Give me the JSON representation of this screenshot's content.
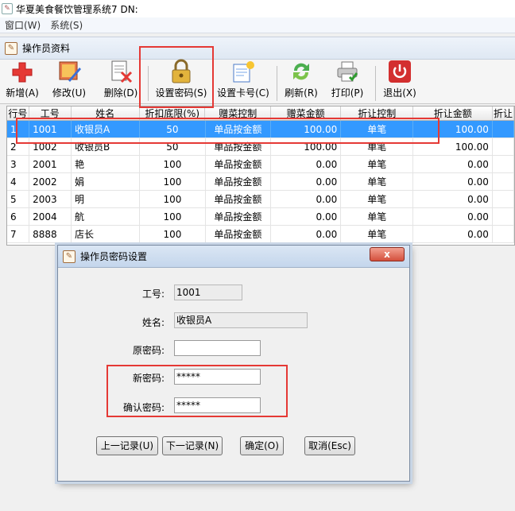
{
  "app": {
    "title": "华夏美食餐饮管理系统7 DN:"
  },
  "menu": [
    "窗口(W)",
    "系统(S)"
  ],
  "subwindow": {
    "title": "操作员资料"
  },
  "toolbar": {
    "add": "新增(A)",
    "edit": "修改(U)",
    "delete": "删除(D)",
    "set_password": "设置密码(S)",
    "set_card": "设置卡号(C)",
    "refresh": "刷新(R)",
    "print": "打印(P)",
    "exit": "退出(X)"
  },
  "grid": {
    "headers": [
      "行号",
      "工号",
      "姓名",
      "折扣底限(%)",
      "赠菜控制",
      "赠菜金额",
      "折让控制",
      "折让金额",
      "折让"
    ],
    "rows": [
      [
        "1",
        "1001",
        "收银员A",
        "50",
        "单品按金额",
        "100.00",
        "单笔",
        "100.00"
      ],
      [
        "2",
        "1002",
        "收银员B",
        "50",
        "单品按金额",
        "100.00",
        "单笔",
        "100.00"
      ],
      [
        "3",
        "2001",
        "艳",
        "100",
        "单品按金额",
        "0.00",
        "单笔",
        "0.00"
      ],
      [
        "4",
        "2002",
        "娟",
        "100",
        "单品按金额",
        "0.00",
        "单笔",
        "0.00"
      ],
      [
        "5",
        "2003",
        "明",
        "100",
        "单品按金额",
        "0.00",
        "单笔",
        "0.00"
      ],
      [
        "6",
        "2004",
        "航",
        "100",
        "单品按金额",
        "0.00",
        "单笔",
        "0.00"
      ],
      [
        "7",
        "8888",
        "店长",
        "100",
        "单品按金额",
        "0.00",
        "单笔",
        "0.00"
      ]
    ]
  },
  "dialog": {
    "title": "操作员密码设置",
    "close": "x",
    "labels": {
      "job_no": "工号:",
      "name": "姓名:",
      "old_pw": "原密码:",
      "new_pw": "新密码:",
      "confirm_pw": "确认密码:"
    },
    "values": {
      "job_no": "1001",
      "name": "收银员A",
      "old_pw": "",
      "new_pw": "*****",
      "confirm_pw": "*****"
    },
    "buttons": {
      "prev": "上一记录(U)",
      "next": "下一记录(N)",
      "ok": "确定(O)",
      "cancel": "取消(Esc)"
    }
  },
  "colors": {
    "selected_row": "#3399ff",
    "annotation": "#e53935",
    "exit_red": "#d32f2f",
    "add_red": "#e53935"
  }
}
